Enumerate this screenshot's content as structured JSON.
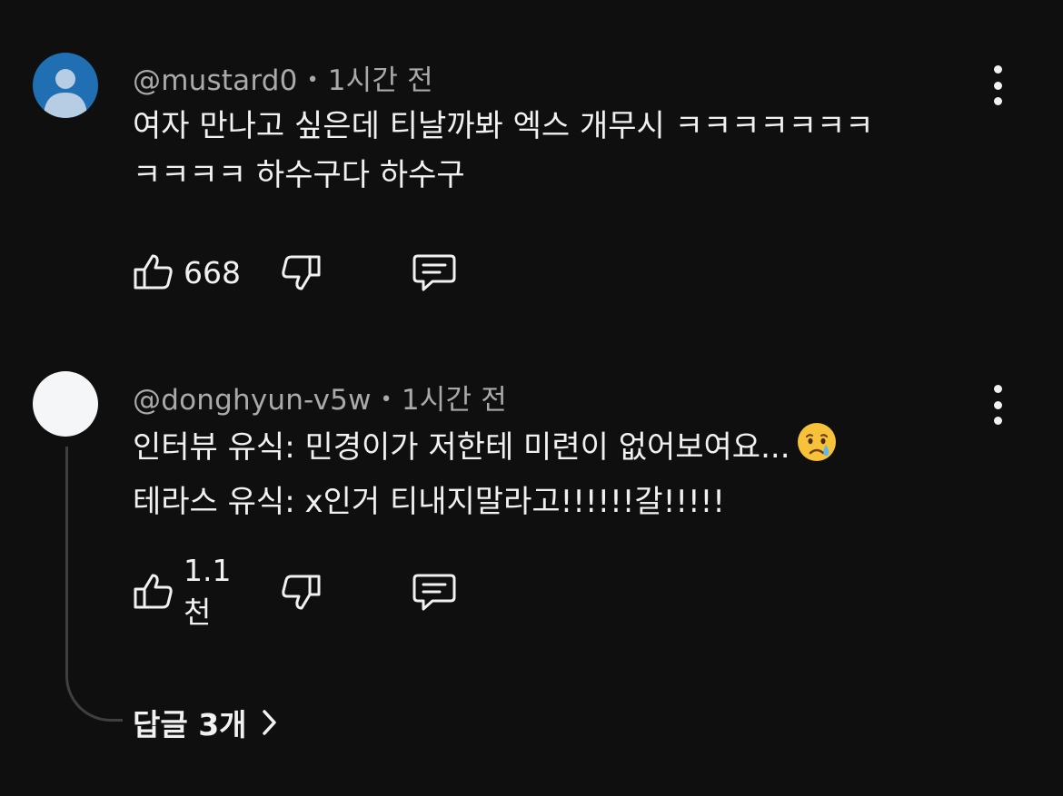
{
  "comments": [
    {
      "author": "@mustard0",
      "separator": "•",
      "time": "1시간 전",
      "text_line1": "여자 만나고 싶은데 티날까봐 엑스 개무시 ㅋㅋㅋㅋㅋㅋㅋ",
      "text_line2": "ㅋㅋㅋㅋ 하수구다 하수구",
      "likes": "668",
      "avatar_color": "#1f6fb2"
    },
    {
      "author": "@donghyun-v5w",
      "separator": "•",
      "time": "1시간 전",
      "text_line1": "인터뷰 유식: 민경이가 저한테 미련이 없어보여요...",
      "text_line2": "테라스 유식: x인거 티내지말라고!!!!!!갈!!!!!",
      "emoji": "crying-face",
      "likes": "1.1천",
      "avatar_color": "#f4f6f8",
      "replies_label": "답글 3개"
    }
  ],
  "icons": {
    "like": "thumbs-up-icon",
    "dislike": "thumbs-down-icon",
    "reply": "reply-icon",
    "more": "more-vert-icon",
    "chevron": "chevron-right-icon"
  },
  "colors": {
    "background": "#0f0f0f",
    "text": "#f1f1f1",
    "meta": "#aaaaaa",
    "thread_line": "#3f3f3f"
  }
}
